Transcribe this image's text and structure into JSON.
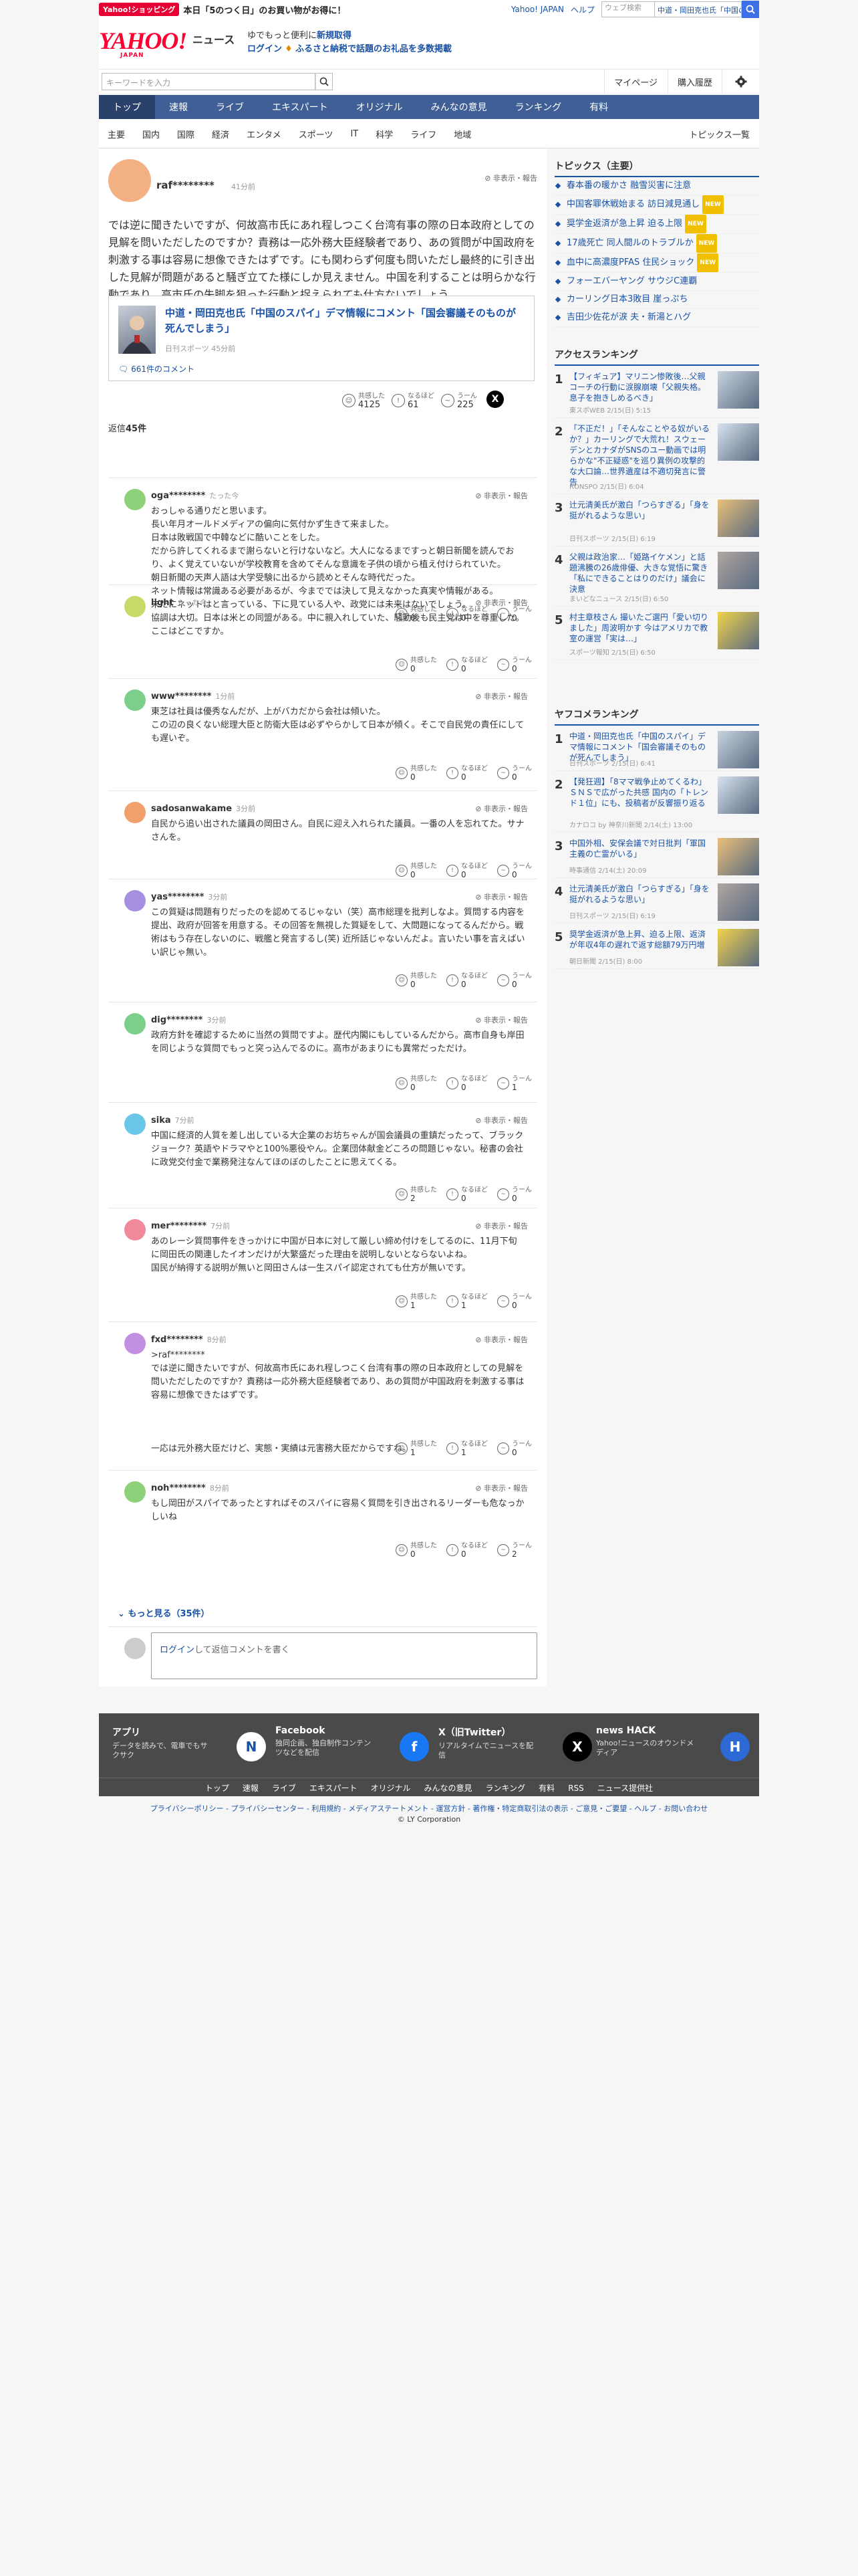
{
  "header": {
    "shopping_tag": "Yahoo!ショッピング",
    "shopping_text": "本日「5のつく日」のお買い物がお得に！",
    "top_links": [
      "Yahoo! JAPAN",
      "ヘルプ"
    ],
    "search_placeholder": "ウェブ検索",
    "search_value": "中道・岡田克也氏「中国のスパイ...",
    "logo_text": "YAHOO!",
    "logo_sub": "JAPAN",
    "logo_news": "ニュース",
    "promo_line1": "ゆでもっと便利に",
    "promo_line1_bold": "新規取得",
    "promo_login": "ログイン",
    "promo_line2": "ふるさと納税で話題のお礼品を多数掲載"
  },
  "search_row": {
    "placeholder": "キーワードを入力",
    "mypage": "マイページ",
    "history": "購入履歴"
  },
  "main_nav": [
    "トップ",
    "速報",
    "ライブ",
    "エキスパート",
    "オリジナル",
    "みんなの意見",
    "ランキング",
    "有料"
  ],
  "sub_nav": [
    "主要",
    "国内",
    "国際",
    "経済",
    "エンタメ",
    "スポーツ",
    "IT",
    "科学",
    "ライフ",
    "地域"
  ],
  "topics_list_link": "トピックス一覧",
  "first_comment": {
    "user": "raf********",
    "time": "41分前",
    "report": "非表示・報告",
    "body": "では逆に聞きたいですが、何故高市氏にあれ程しつこく台湾有事の際の日本政府としての見解を問いただしたのですか？責務は一応外務大臣経験者であり、あの質問が中国政府を刺激する事は容易に想像できたはずです。にも関わらず何度も問いただし最終的に引き出した見解が問題があると騒ぎ立てた様にしか見えません。中国を利することは明らかな行動であり、高市氏の失脚を狙った行動と捉えられても仕方ないでしょう。",
    "article_title": "中道・岡田克也氏「中国のスパイ」デマ情報にコメント「国会審議そのものが死んでしまう」",
    "article_source": "日刊スポーツ 45分前",
    "article_comments": "661件のコメント",
    "reactions": [
      {
        "label": "共感した",
        "count": "4125"
      },
      {
        "label": "なるほど",
        "count": "61"
      },
      {
        "label": "うーん",
        "count": "225"
      }
    ]
  },
  "reply_count_label": "返信",
  "reply_count": "45件",
  "replies": [
    {
      "user": "oga********",
      "time": "たった今",
      "body": "おっしゃる通りだと思います。\n長い年月オールドメディアの偏向に気付かず生きて来ました。\n日本は敗戦国で中韓などに酷いことをした。\nだから許してくれるまで謝らないと行けないなど。大人になるまですっと朝日新聞を読んでおり、よく覚えていないが学校教育を含めてそんな意識を子供の頃から植え付けられていた。\n朝日新聞の天声人語は大学受験に出るから読めとそんな時代だった。\nネット情報は常識ある必要があるが、今まででは決して見えなかった真実や情報がある。\n未だにネットはと言っている、下に見ている人や、政党には未来はないでしょう。",
      "reactions": [
        "0",
        "0",
        "0"
      ],
      "color": "#8fd17a"
    },
    {
      "user": "light",
      "time": "たった今",
      "body": "協調は大切。日本は米との同盟がある。中に親入れしていた、騒動後も民主党は中を尊重した。ここはどこですか。",
      "reactions": [
        "0",
        "0",
        "0"
      ],
      "color": "#c9d96a"
    },
    {
      "user": "www********",
      "time": "1分前",
      "body": "東芝は社員は優秀なんだが、上がバカだから会社は傾いた。\nこの辺の良くない総理大臣と防衛大臣は必ずやらかして日本が傾く。そこで自民党の責任にしても遅いぞ。",
      "reactions": [
        "0",
        "0",
        "0"
      ],
      "color": "#7ccf8a"
    },
    {
      "user": "sadosanwakame",
      "time": "3分前",
      "body": "自民から追い出された議員の岡田さん。自民に迎え入れられた議員。一番の人を忘れてた。サナさんを。",
      "reactions": [
        "0",
        "0",
        "0"
      ],
      "color": "#f0a06a"
    },
    {
      "user": "yas********",
      "time": "3分前",
      "body": "この質疑は問題有りだったのを認めてるじゃない（笑）高市総理を批判しなよ。質問する内容を提出、政府が回答を用意する。その回答を無視した質疑をして、大問題になってるんだから。戦術はもう存在しないのに、戦艦と発言するし(笑) 近所話じゃないんだよ。言いたい事を言えばいい訳じゃ無い。",
      "reactions": [
        "0",
        "0",
        "0"
      ],
      "color": "#a58fe0"
    },
    {
      "user": "dig********",
      "time": "3分前",
      "body": "政府方針を確認するために当然の質問ですよ。歴代内閣にもしているんだから。高市自身も岸田を同じような質問でもっと突っ込んでるのに。高市があまりにも異常だっただけ。",
      "reactions": [
        "0",
        "0",
        "1"
      ],
      "color": "#7ccf8a"
    },
    {
      "user": "sika",
      "time": "7分前",
      "body": "中国に経済的人質を差し出している大企業のお坊ちゃんが国会議員の重鎮だったって、ブラックジョーク？英語やドラマやと100%悪役やん。企業団体献金どころの問題じゃない。秘書の会社に政党交付金で業務発注なんてほのぼのしたことに思えてくる。",
      "reactions": [
        "2",
        "0",
        "0"
      ],
      "color": "#6ac7e8"
    },
    {
      "user": "mer********",
      "time": "7分前",
      "body": "あのレーシ質問事件をきっかけに中国が日本に対して厳しい締め付けをしてるのに、11月下旬に岡田氏の関連したイオンだけが大繁盛だった理由を説明しないとならないよね。\n国民が納得する説明が無いと岡田さんは一生スパイ認定されても仕方が無いです。",
      "reactions": [
        "1",
        "1",
        "0"
      ],
      "color": "#f08a9a"
    },
    {
      "user": "fxd********",
      "time": "8分前",
      "body": ">raf********\nでは逆に聞きたいですが、何故高市氏にあれ程しつこく台湾有事の際の日本政府としての見解を問いただしたのですか？責務は一応外務大臣経験者であり、あの質問が中国政府を刺激する事は容易に想像できたはずです。\n\n\n\n一応は元外務大臣だけど、実態・実績は元害務大臣だからですね。",
      "reactions": [
        "1",
        "1",
        "0"
      ],
      "color": "#c38fe0"
    },
    {
      "user": "noh********",
      "time": "8分前",
      "body": "もし岡田がスパイであったとすればそのスパイに容易く質問を引き出されるリーダーも危なっかしいね",
      "reactions": [
        "0",
        "0",
        "2"
      ],
      "color": "#8fd17a"
    }
  ],
  "reaction_labels": [
    "共感した",
    "なるほど",
    "うーん"
  ],
  "more_link": "もっと見る（35件）",
  "reply_box": {
    "login": "ログイン",
    "text": "して返信コメントを書く"
  },
  "topics": {
    "title": "トピックス（主要）",
    "items": [
      {
        "text": "春本番の暖かさ 融雪災害に注意",
        "badge": ""
      },
      {
        "text": "中国客罪休戦始まる 訪日減見通し",
        "badge": "NEW"
      },
      {
        "text": "奨学金返済が急上昇 迫る上限",
        "badge": "NEW"
      },
      {
        "text": "17歳死亡 同人間ルのトラブルか",
        "badge": "NEW"
      },
      {
        "text": "血中に高濃度PFAS 住民ショック",
        "badge": "NEW"
      },
      {
        "text": "フォーエバーヤング サウジC連覇",
        "badge": ""
      },
      {
        "text": "カーリング日本3敗目 崖っぷち",
        "badge": ""
      },
      {
        "text": "吉田少佐花が涙 夫・新湯とハグ",
        "badge": ""
      }
    ]
  },
  "access_ranking": {
    "title": "アクセスランキング",
    "items": [
      {
        "rank": "1",
        "title": "【フィギュア】マリニン惨敗後…父親コーチの行動に涙腺崩壊「父親失格。息子を抱きしめるべき」",
        "meta": "東スポWEB 2/15(日) 5:15"
      },
      {
        "rank": "2",
        "title": "「不正だ！」「そんなことやる奴がいるか？」カーリングで大荒れ！スウェーデンとカナダがSNSのユー動画では明らかな\"不正疑惑\"を巡り異例の攻撃的な大口論…世界遺産は不適切発言に警告",
        "meta": "RONSPO 2/15(日) 6:04"
      },
      {
        "rank": "3",
        "title": "辻元清美氏が激白「つらすぎる」「身を挺がれるような思い」",
        "meta": "日刊スポーツ 2/15(日) 6:19"
      },
      {
        "rank": "4",
        "title": "父親は政治家…「姫路イケメン」と話題沸騰の26歳俳優、大きな覚悟に驚き「私にできることはりのだけ」議会に決意",
        "meta": "まいどなニュース 2/15(日) 6:50"
      },
      {
        "rank": "5",
        "title": "村主章枝さん 撮いたご選円「愛い切りました」周波明かす 今はアメリカで教室の運営「実は…」",
        "meta": "スポーツ報知 2/15(日) 6:50"
      }
    ]
  },
  "comment_ranking": {
    "title": "ヤフコメランキング",
    "items": [
      {
        "rank": "1",
        "title": "中道・岡田克也氏「中国のスパイ」デマ情報にコメント「国会審議そのものが死んでしまう」",
        "meta": "日刊スポーツ 2/15(日) 6:41"
      },
      {
        "rank": "2",
        "title": "【発狂週】「8ママ戦争止めてくるわ」ＳＮＳで広がった共感 国内の「トレンド１位」にも、投稿者が反響振り返る",
        "meta": "カナロコ by 神奈川新聞 2/14(土) 13:00"
      },
      {
        "rank": "3",
        "title": "中国外相、安保会議で対日批判「軍国主義の亡霊がいる」",
        "meta": "時事通信 2/14(土) 20:09"
      },
      {
        "rank": "4",
        "title": "辻元清美氏が激白「つらすぎる」「身を挺がれるような思い」",
        "meta": "日刊スポーツ 2/15(日) 6:19"
      },
      {
        "rank": "5",
        "title": "奨学金返済が急上昇、迫る上限、返済が年収4年の遅れで返す総額79万円増",
        "meta": "朝日新聞 2/15(日) 8:00"
      }
    ]
  },
  "footer": {
    "cards": [
      {
        "title": "アプリ",
        "desc": "データを読みで、電車でもサクサク",
        "icon": "N"
      },
      {
        "title": "Facebook",
        "desc": "独同企画、独自制作コンテンツなどを配信",
        "icon": "f"
      },
      {
        "title": "X（旧Twitter）",
        "desc": "リアルタイムでニュースを配信",
        "icon": "X"
      },
      {
        "title": "news HACK",
        "desc": "Yahoo!ニュースのオウンドメディア",
        "icon": "H"
      }
    ],
    "links": [
      "トップ",
      "速報",
      "ライブ",
      "エキスパート",
      "オリジナル",
      "みんなの意見",
      "ランキング",
      "有料",
      "RSS",
      "ニュース提供社"
    ],
    "policy": "プライバシーポリシー - プライバシーセンター - 利用規約 - メディアステートメント - 運営方針 - 著作権・特定商取引法の表示 - ご意見・ご要望 - ヘルプ - お問い合わせ",
    "copyright": "© LY Corporation"
  },
  "colors": {
    "brand_red": "#ff0033",
    "nav_blue": "#3f5f96",
    "link_blue": "#1a52a5"
  }
}
